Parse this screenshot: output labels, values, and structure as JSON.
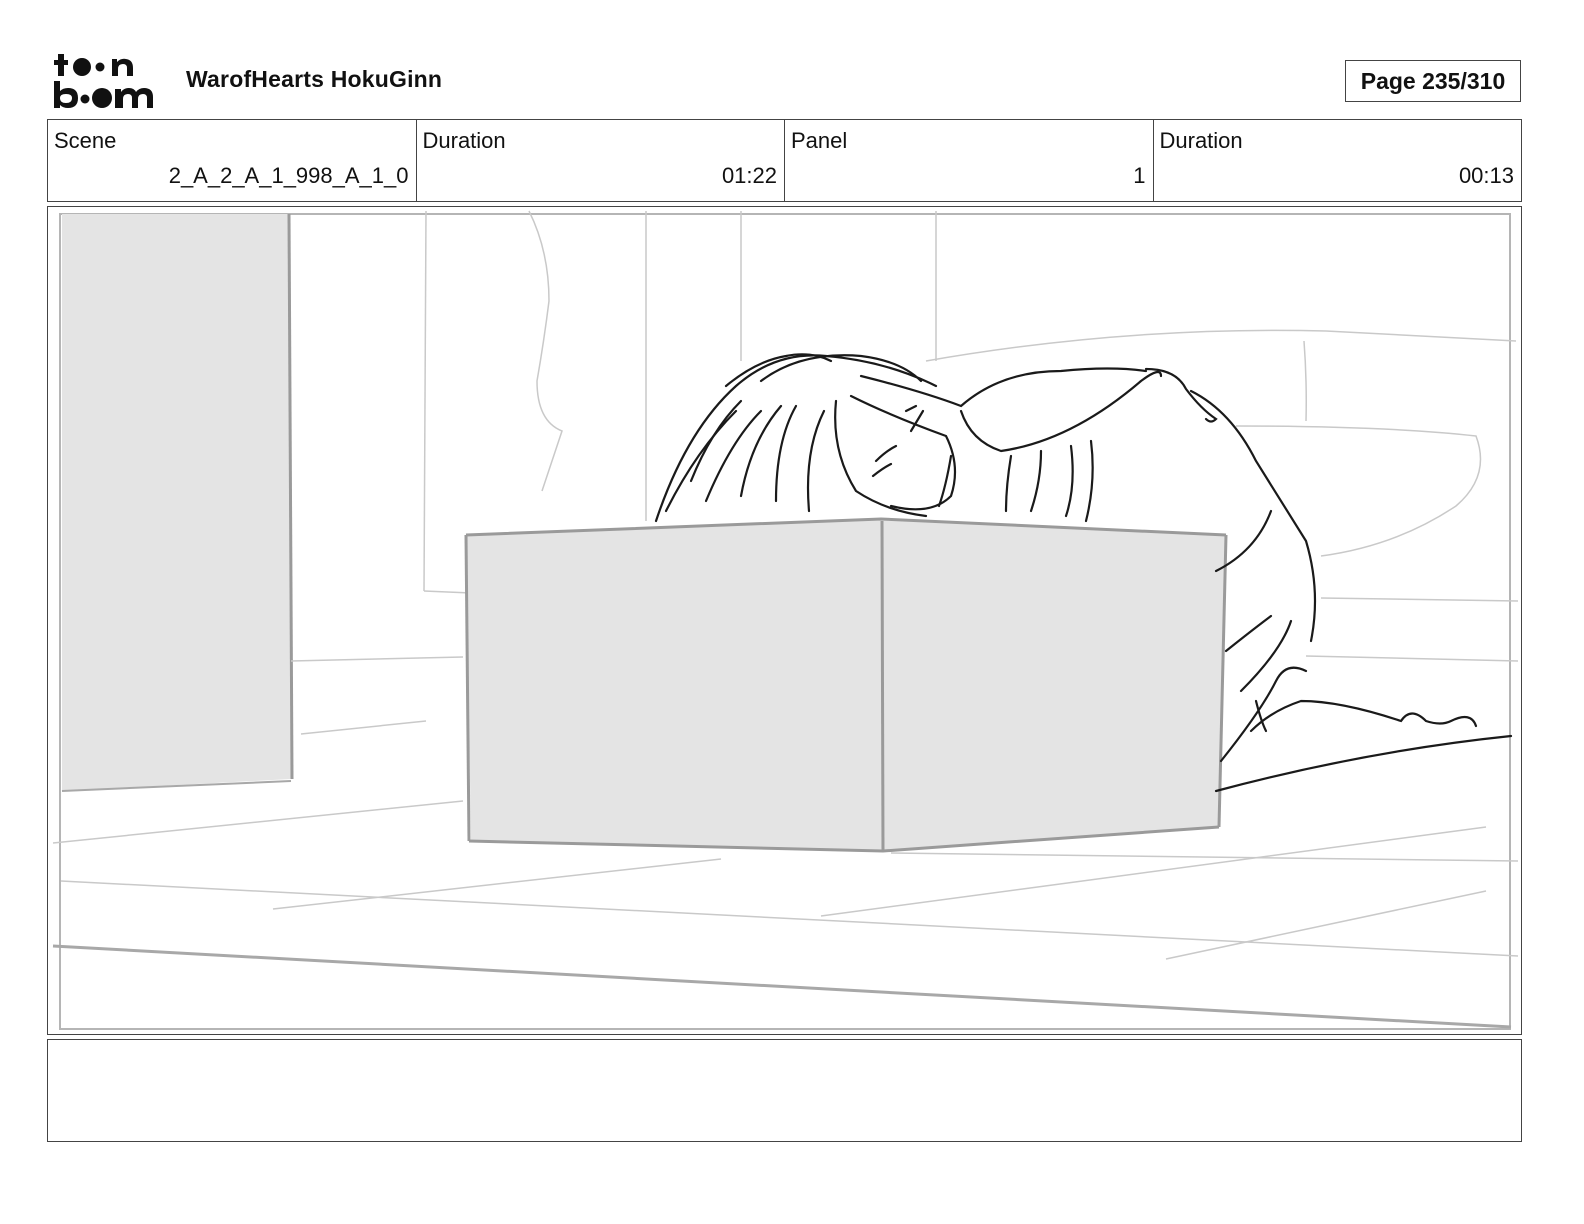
{
  "header": {
    "logo_name": "toon-boom-logo",
    "project_title": "WarofHearts HokuGinn",
    "page_label": "Page 235/310"
  },
  "info": {
    "scene_label": "Scene",
    "scene_value": "2_A_2_A_1_998_A_1_0",
    "scene_duration_label": "Duration",
    "scene_duration_value": "01:22",
    "panel_label": "Panel",
    "panel_value": "1",
    "panel_duration_label": "Duration",
    "panel_duration_value": "00:13"
  },
  "notes": {
    "text": ""
  }
}
